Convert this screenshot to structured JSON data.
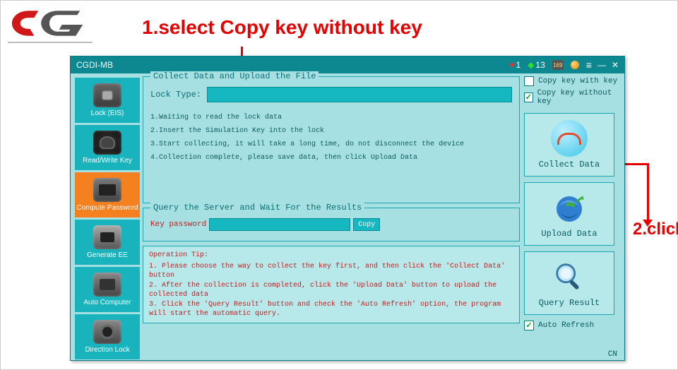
{
  "annotations": {
    "step1": "1.select Copy key without key",
    "step2": "2.click"
  },
  "app": {
    "title": "CGDI-MB",
    "status": {
      "heart_count": "1",
      "diamond_count": "13",
      "calendar": "169"
    },
    "footer_lang": "CN"
  },
  "sidebar": {
    "items": [
      {
        "label": "Lock (EIS)"
      },
      {
        "label": "Read/Write Key"
      },
      {
        "label": "Compute Password"
      },
      {
        "label": "Generate EE"
      },
      {
        "label": "Auto Computer"
      },
      {
        "label": "Direction Lock"
      }
    ]
  },
  "collect_panel": {
    "legend": "Collect Data and Upload the File",
    "locktype_label": "Lock Type:",
    "steps": [
      "1.Waiting to read the lock data",
      "2.Insert the Simulation Key into the lock",
      "3.Start collecting, it will take a long time, do not disconnect the device",
      "4.Collection complete, please save data, then click Upload Data"
    ]
  },
  "query_panel": {
    "legend": "Query the Server and Wait For the Results",
    "keypass_label": "Key password",
    "copy_btn": "Copy"
  },
  "tip": {
    "title": "Operation Tip:",
    "lines": [
      "1. Please choose the way to collect the key first, and then click the 'Collect Data' button",
      "2. After the collection is completed, click the 'Upload Data' button to upload the collected data",
      "3. Click the 'Query Result' button and check the 'Auto Refresh' option, the program will start the automatic query."
    ]
  },
  "right": {
    "chk_with": "Copy key with key",
    "chk_without": "Copy key without key",
    "collect": "Collect Data",
    "upload": "Upload  Data",
    "query": "Query Result",
    "auto_refresh": "Auto Refresh"
  }
}
